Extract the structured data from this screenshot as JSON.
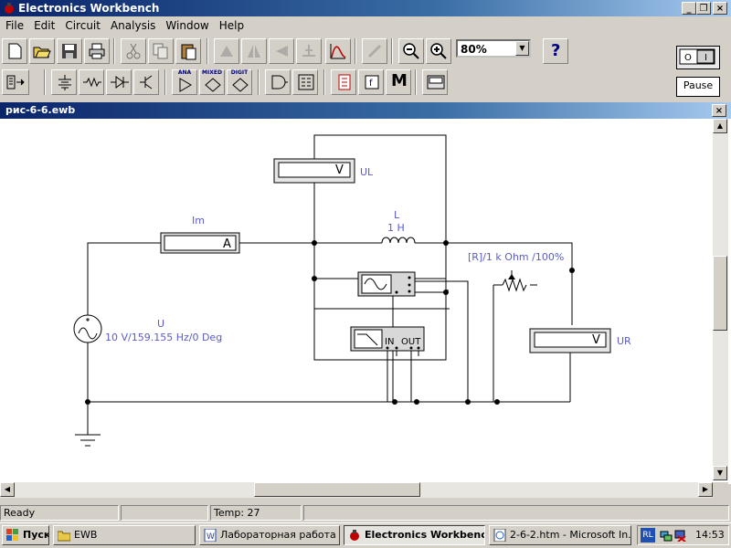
{
  "app": {
    "title": "Electronics Workbench",
    "caption_buttons": [
      "_",
      "❐",
      "×"
    ]
  },
  "menu": [
    "File",
    "Edit",
    "Circuit",
    "Analysis",
    "Window",
    "Help"
  ],
  "toolbar": {
    "zoom_value": "80%",
    "help_label": "?",
    "pause_label": "Pause"
  },
  "parts_bin": {
    "ana_label": "ANA",
    "mixed_label": "MIXED",
    "digit_label": "DIGIT",
    "misc_label": "M"
  },
  "document": {
    "title": "рис-6-6.ewb",
    "close_label": "×"
  },
  "circuit": {
    "voltmeter_ul": {
      "display": "V",
      "label": "UL"
    },
    "ammeter": {
      "display": "A",
      "label": "Im"
    },
    "inductor": {
      "name": "L",
      "value": "1 H"
    },
    "potentiometer": {
      "label": "[R]/1 k Ohm /100%"
    },
    "voltmeter_ur": {
      "display": "V",
      "label": "UR"
    },
    "source": {
      "name": "U",
      "value": "10 V/159.155 Hz/0 Deg"
    },
    "bode_plotter": {
      "in_label": "IN",
      "out_label": "OUT"
    }
  },
  "status": {
    "ready": "Ready",
    "temp": "Temp:  27"
  },
  "taskbar": {
    "start_label": "Пуск",
    "tasks": [
      {
        "label": "EWB"
      },
      {
        "label": "Лабораторная работа ..."
      },
      {
        "label": "Electronics Workbench"
      },
      {
        "label": "2-6-2.htm - Microsoft In..."
      }
    ],
    "tray_lang": "RL",
    "clock": "14:53"
  },
  "colors": {
    "titlebar": "#0a246a",
    "circuit_label": "#5a5ad0",
    "wire": "#000000"
  }
}
